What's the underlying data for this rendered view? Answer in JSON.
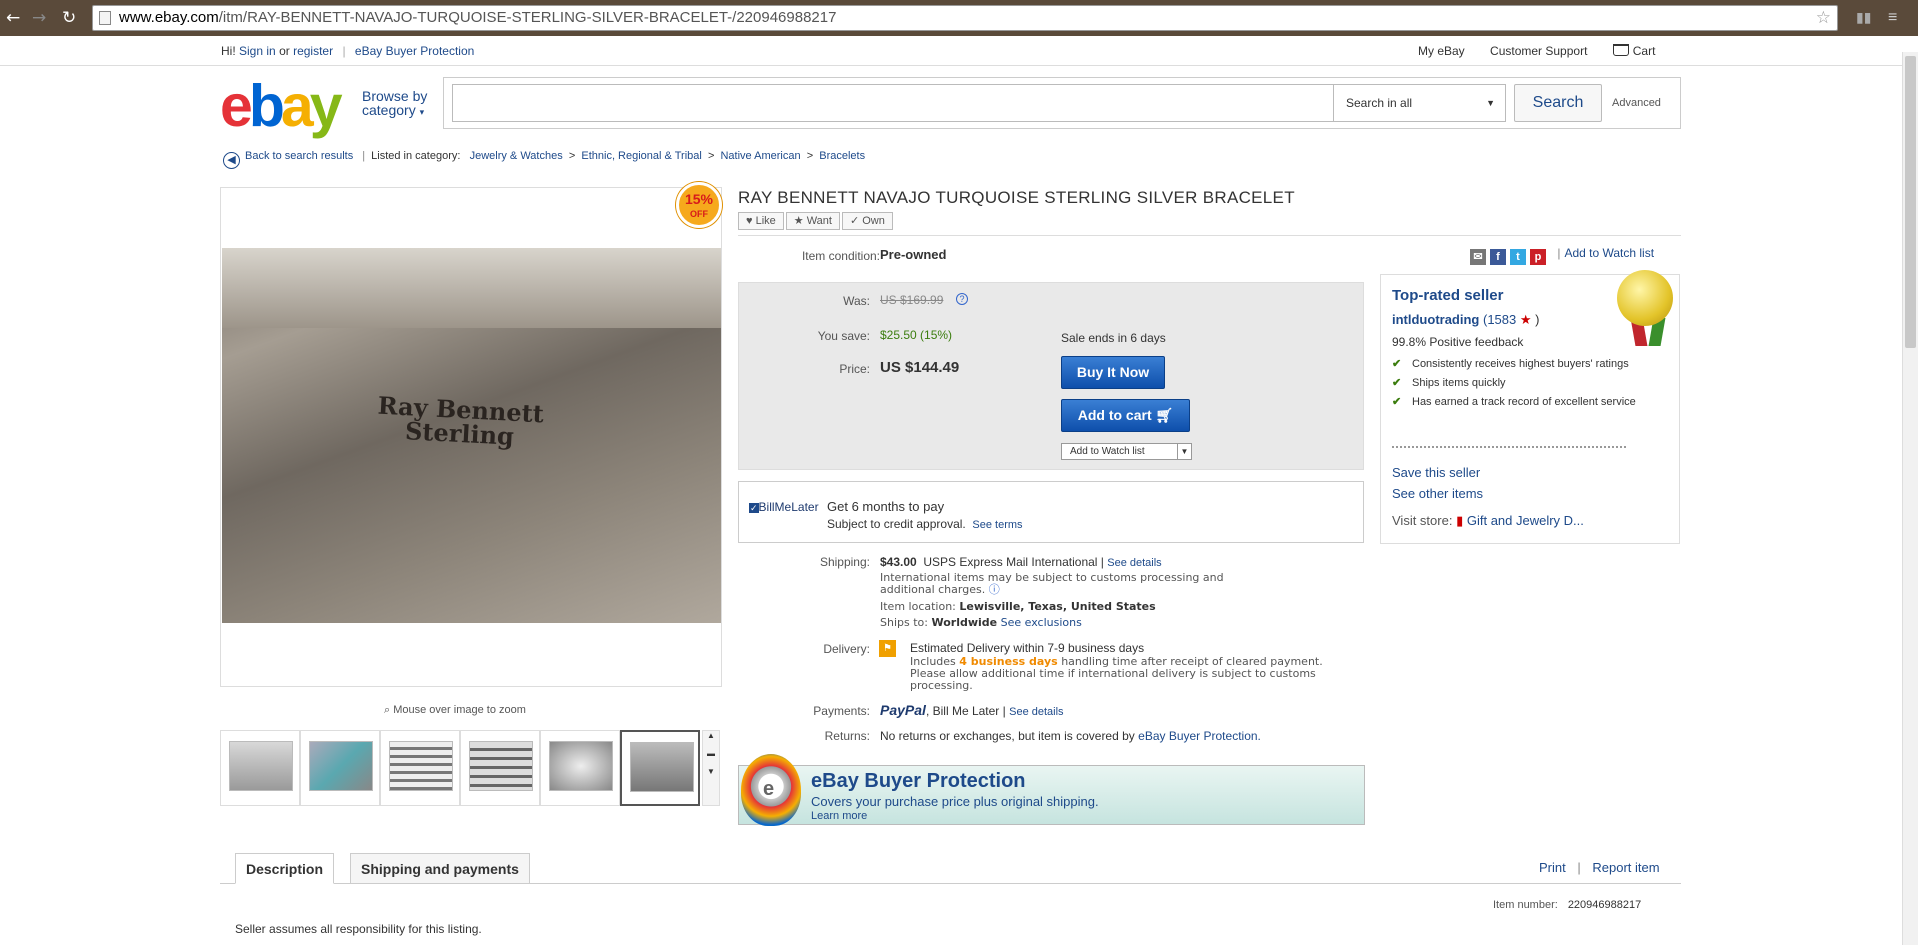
{
  "browser": {
    "url_domain": "www.ebay.com",
    "url_path": "/itm/RAY-BENNETT-NAVAJO-TURQUOISE-STERLING-SILVER-BRACELET-/220946988217"
  },
  "topbar": {
    "hi": "Hi!",
    "sign_in": "Sign in",
    "or": "or",
    "register": "register",
    "buyer_protection": "eBay Buyer Protection",
    "my_ebay": "My eBay",
    "customer_support": "Customer Support",
    "cart": "Cart"
  },
  "header": {
    "browse_line1": "Browse by",
    "browse_line2": "category",
    "search_placeholder": "",
    "search_category": "Search in all",
    "search_button": "Search",
    "advanced": "Advanced"
  },
  "breadcrumb": {
    "back": "Back to search results",
    "listed_in": "Listed in category:",
    "items": [
      "Jewelry & Watches",
      "Ethnic, Regional & Tribal",
      "Native American",
      "Bracelets"
    ]
  },
  "image": {
    "badge_pct": "15%",
    "badge_off": "OFF",
    "stamp_line1": "Ray Bennett",
    "stamp_line2": "Sterling",
    "zoom_hint": "Mouse over image to zoom"
  },
  "item": {
    "title": "RAY BENNETT NAVAJO TURQUOISE STERLING SILVER BRACELET",
    "social": [
      "Like",
      "Want",
      "Own"
    ],
    "condition_label": "Item condition:",
    "condition": "Pre-owned",
    "add_watch": "Add to Watch list",
    "was_label": "Was:",
    "was": "US $169.99",
    "save_label": "You save:",
    "save": "$25.50 (15%)",
    "price_label": "Price:",
    "price": "US $144.49",
    "sale_ends": "Sale ends in 6 days",
    "buy_now": "Buy It Now",
    "add_to_cart": "Add to cart",
    "watch_list_btn": "Add to Watch list"
  },
  "bml": {
    "logo": "BillMeLater",
    "line1": "Get 6 months to pay",
    "line2": "Subject to credit approval.",
    "terms": "See terms"
  },
  "shipping": {
    "label": "Shipping:",
    "cost": "$43.00",
    "method": "USPS Express Mail International |",
    "details": "See details",
    "note1": "International items may be subject to customs processing and",
    "note2": "additional charges.",
    "location_label": "Item location:",
    "location": "Lewisville, Texas, United States",
    "ships_to_label": "Ships to:",
    "ships_to": "Worldwide",
    "exclusions": "See exclusions"
  },
  "delivery": {
    "label": "Delivery:",
    "estimate": "Estimated Delivery within 7-9 business days",
    "includes": "Includes",
    "days": "4 business days",
    "after": "handling time after receipt of cleared payment.",
    "line2": "Please allow additional time if international delivery is subject to customs",
    "line3": "processing."
  },
  "payments": {
    "label": "Payments:",
    "paypal": "PayPal",
    "bml": "Bill Me Later |",
    "details": "See details"
  },
  "returns": {
    "label": "Returns:",
    "text": "No returns or exchanges, but item is covered by",
    "link": "eBay Buyer Protection."
  },
  "protection": {
    "title": "eBay Buyer Protection",
    "subtitle": "Covers your purchase price plus original shipping.",
    "learn": "Learn more"
  },
  "seller": {
    "top_rated": "Top-rated seller",
    "name": "intlduotrading",
    "score": "(1583",
    "score_end": ")",
    "positive": "99.8% Positive feedback",
    "bullets": [
      "Consistently receives highest buyers' ratings",
      "Ships items quickly",
      "Has earned a track record of excellent service"
    ],
    "save_seller": "Save this seller",
    "other_items": "See other items",
    "visit_store": "Visit store:",
    "store_name": "Gift and Jewelry D..."
  },
  "tabs": {
    "description": "Description",
    "shipping": "Shipping and payments",
    "print": "Print",
    "report": "Report item",
    "item_number_label": "Item number:",
    "item_number": "220946988217",
    "desc_text": "Seller assumes all responsibility for this listing."
  },
  "colors": {
    "link": "#1e4a8a",
    "price_box": "#e9e9e9",
    "buy_button": "#1a5fbf",
    "save_green": "#3b7d0e"
  }
}
